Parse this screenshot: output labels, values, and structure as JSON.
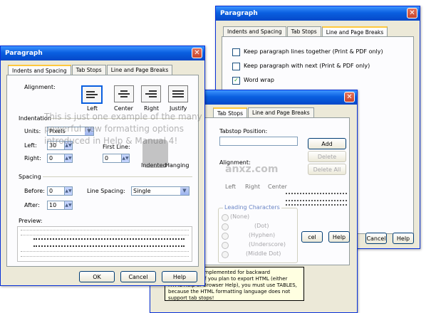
{
  "dlg_back": {
    "title": "Paragraph",
    "tabs": [
      "Indents and Spacing",
      "Tab Stops",
      "Line and Page Breaks"
    ],
    "keep_together": "Keep paragraph lines together  (Print & PDF only)",
    "keep_next": "Keep paragraph with next  (Print & PDF only)",
    "word_wrap": "Word wrap",
    "cancel": "Cancel",
    "help": "Help"
  },
  "dlg_mid": {
    "tabs": [
      "Tab Stops",
      "Line and Page Breaks"
    ],
    "tabstop_position": "Tabstop Position:",
    "alignment": "Alignment:",
    "align_options": [
      "Left",
      "Right",
      "Center"
    ],
    "add": "Add",
    "delete": "Delete",
    "delete_all": "Delete All",
    "leading_characters": "Leading Characters",
    "leading_options": [
      "(None)",
      "(Dot)",
      "(Hyphen)",
      "(Underscore)",
      "(Middle Dot)"
    ],
    "note": "Tab stops are implemented for backward compatibility. If you plan to export HTML (either HTML Help or Browser Help), you must use TABLES, because the HTML formatting language does not support tab stops!"
  },
  "dlg_front": {
    "title": "Paragraph",
    "tabs": [
      "Indents and Spacing",
      "Tab Stops",
      "Line and Page Breaks"
    ],
    "alignment_label": "Alignment:",
    "align_buttons": [
      "Left",
      "Center",
      "Right",
      "Justify"
    ],
    "indentation_label": "Indentation",
    "units_label": "Units:",
    "units_value": "Pixels",
    "left_label": "Left:",
    "left_value": "30",
    "right_label": "Right:",
    "right_value": "0",
    "first_line_label": "First Line:",
    "first_line_value": "0",
    "indented": "Indented",
    "hanging": "Hanging",
    "spacing_label": "Spacing",
    "before_label": "Before:",
    "before_value": "0",
    "after_label": "After:",
    "after_value": "10",
    "line_spacing_label": "Line Spacing:",
    "line_spacing_value": "Single",
    "preview_label": "Preview:",
    "ok": "OK",
    "cancel": "Cancel",
    "help": "Help"
  },
  "overlay_text": "This is just one example of the many powerful new formatting options introduced in Help & Manual 4!",
  "watermark": "anxz.com"
}
